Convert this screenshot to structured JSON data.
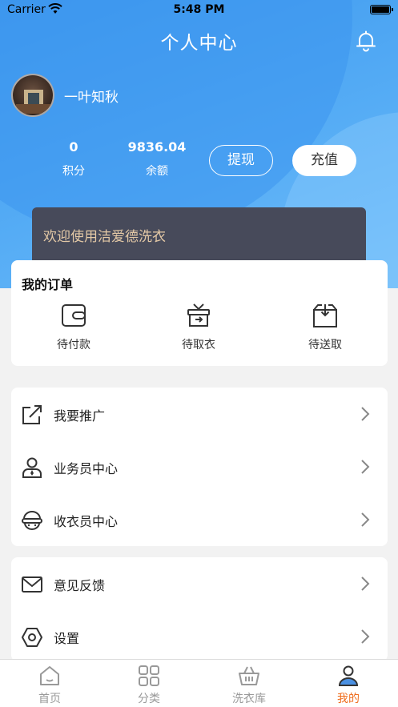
{
  "status_bar": {
    "carrier": "Carrier",
    "time": "5:48 PM"
  },
  "header": {
    "title": "个人中心",
    "bell_icon": "bell-icon"
  },
  "profile": {
    "username": "一叶知秋"
  },
  "stats": [
    {
      "value": "0",
      "label": "积分"
    },
    {
      "value": "9836.04",
      "label": "余额"
    }
  ],
  "actions": {
    "withdraw": "提现",
    "recharge": "充值"
  },
  "banner": {
    "text": "欢迎使用洁爱德洗衣"
  },
  "orders": {
    "title": "我的订单",
    "items": [
      {
        "label": "待付款",
        "icon": "wallet-icon"
      },
      {
        "label": "待取衣",
        "icon": "gift-box-icon"
      },
      {
        "label": "待送取",
        "icon": "package-icon"
      }
    ]
  },
  "menu_group_1": [
    {
      "label": "我要推广",
      "icon": "share-icon"
    },
    {
      "label": "业务员中心",
      "icon": "salesperson-icon"
    },
    {
      "label": "收衣员中心",
      "icon": "courier-icon"
    }
  ],
  "menu_group_2": [
    {
      "label": "意见反馈",
      "icon": "mail-icon"
    },
    {
      "label": "设置",
      "icon": "settings-icon"
    }
  ],
  "tabbar": [
    {
      "label": "首页",
      "icon": "home-icon"
    },
    {
      "label": "分类",
      "icon": "grid-icon"
    },
    {
      "label": "洗衣库",
      "icon": "basket-icon"
    },
    {
      "label": "我的",
      "icon": "user-icon",
      "active": true
    }
  ],
  "colors": {
    "primary": "#3d98ee",
    "accent": "#ef6c1c",
    "banner_bg": "#474a5a",
    "banner_text": "#e4c9a6"
  }
}
